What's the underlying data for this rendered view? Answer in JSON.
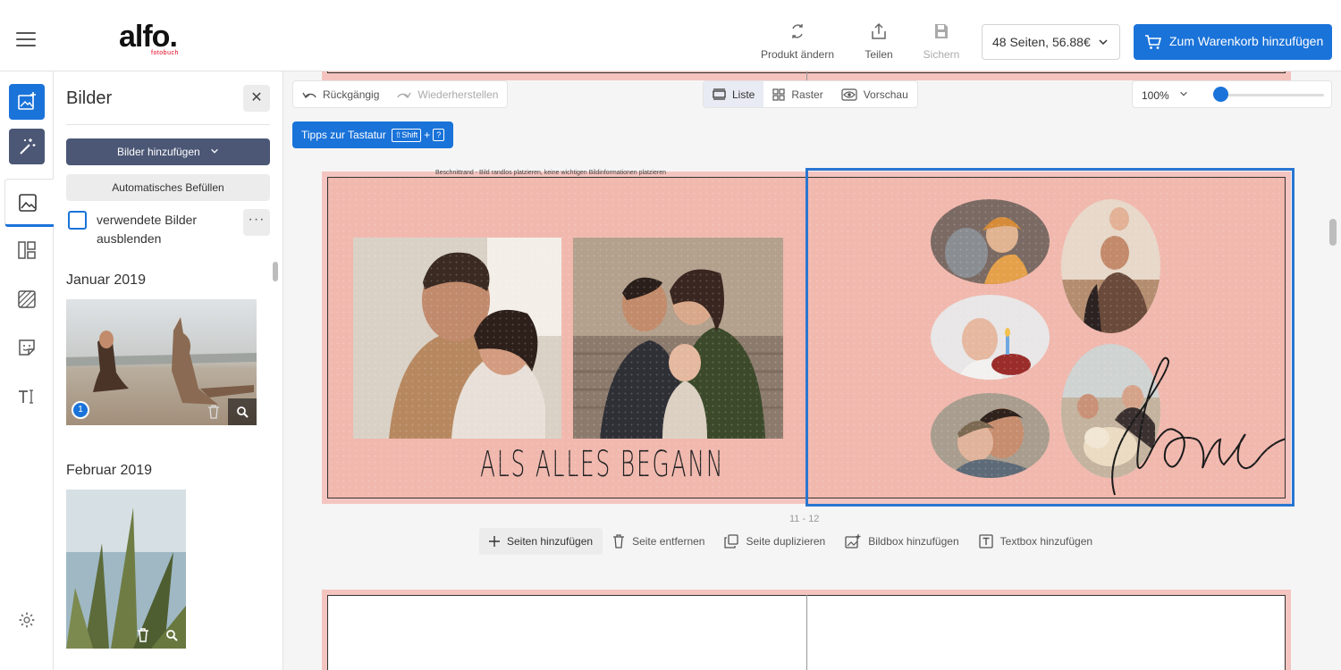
{
  "header": {
    "brand": "alfo.",
    "brand_sub": "fotobuch",
    "actions": [
      {
        "label": "Produkt ändern",
        "icon": "swap-icon"
      },
      {
        "label": "Teilen",
        "icon": "share-icon"
      },
      {
        "label": "Sichern",
        "icon": "save-icon"
      }
    ],
    "pages_select": "48 Seiten, 56.88€",
    "cart_button": "Zum Warenkorb hinzufügen"
  },
  "sidebar_panel": {
    "title": "Bilder",
    "add_images": "Bilder hinzufügen",
    "autofill": "Automatisches Befüllen",
    "hide_used_label": "verwendete Bilder ausblenden",
    "hide_used_checked": false,
    "more": "···",
    "groups": [
      {
        "month": "Januar 2019",
        "usage_count": "1"
      },
      {
        "month": "Februar 2019"
      }
    ]
  },
  "editor_toolbar": {
    "undo": "Rückgängig",
    "redo": "Wiederherstellen",
    "views": [
      {
        "label": "Liste",
        "active": true
      },
      {
        "label": "Raster",
        "active": false
      },
      {
        "label": "Vorschau",
        "active": false
      }
    ],
    "tips": "Tipps zur Tastatur",
    "tips_key1": "⇧Shift",
    "tips_plus": "+",
    "tips_key2": "?",
    "zoom": "100%",
    "zoom_level": 0.05
  },
  "spread": {
    "bleed_note": "Beschnittrand - Bild randlos platzieren, keine wichtigen Bildinformationen platzieren",
    "title_text": "ALS ALLES BEGANN",
    "script_text": "love",
    "page_numbers": "11 - 12",
    "colors": {
      "page_bg": "#f1b8ae",
      "selection": "#2a76d2",
      "accent": "#1a73d9"
    }
  },
  "page_actions": [
    {
      "label": "Seiten hinzufügen",
      "icon": "plus-icon"
    },
    {
      "label": "Seite entfernen",
      "icon": "trash-icon"
    },
    {
      "label": "Seite duplizieren",
      "icon": "duplicate-icon"
    },
    {
      "label": "Bildbox hinzufügen",
      "icon": "image-box-icon"
    },
    {
      "label": "Textbox hinzufügen",
      "icon": "text-box-icon"
    }
  ]
}
